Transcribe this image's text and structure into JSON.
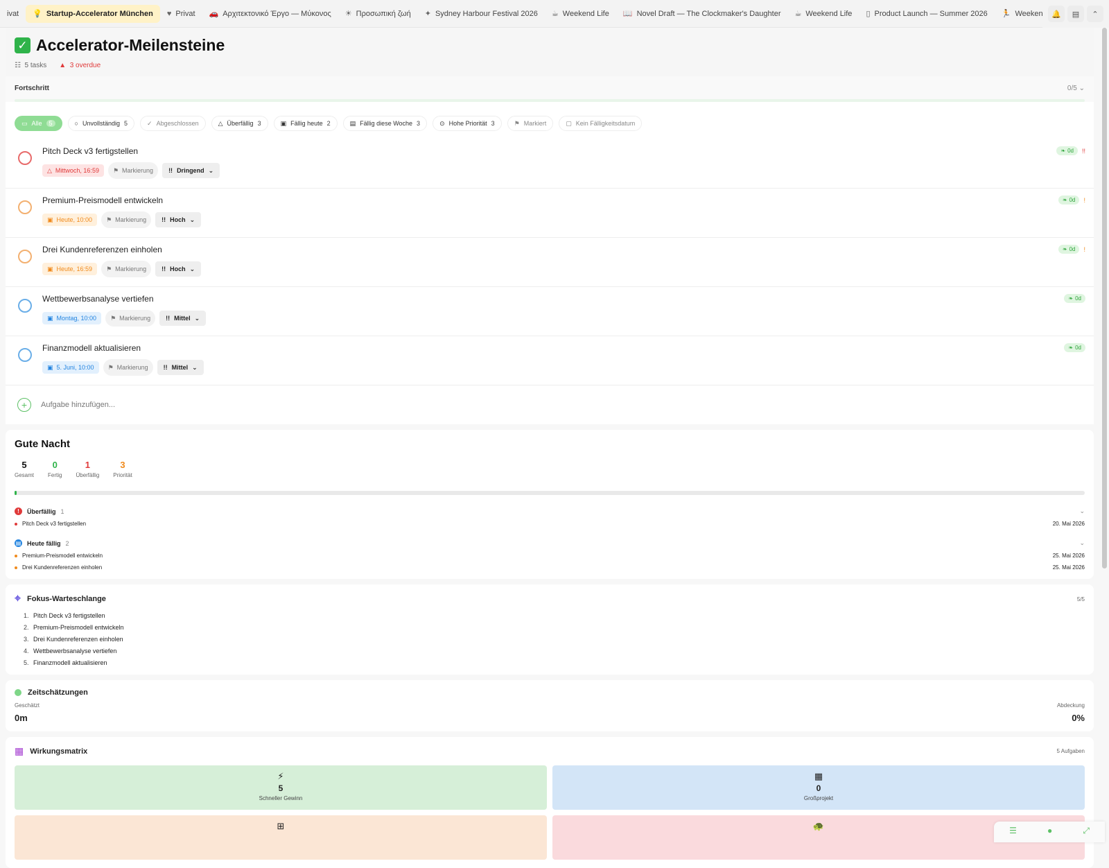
{
  "tabs": [
    {
      "label": "ivat",
      "icon": "heart-icon",
      "active": false
    },
    {
      "label": "Startup-Accelerator München",
      "icon": "lightbulb-icon",
      "active": true
    },
    {
      "label": "Privat",
      "icon": "heart-icon",
      "active": false
    },
    {
      "label": "Αρχιτεκτονικό Έργο — Μύκονος",
      "icon": "car-icon",
      "active": false
    },
    {
      "label": "Προσωπική ζωή",
      "icon": "sun-icon",
      "active": false
    },
    {
      "label": "Sydney Harbour Festival 2026",
      "icon": "sparkle-icon",
      "active": false
    },
    {
      "label": "Weekend Life",
      "icon": "cup-icon",
      "active": false
    },
    {
      "label": "Novel Draft — The Clockmaker's Daughter",
      "icon": "book-icon",
      "active": false
    },
    {
      "label": "Weekend Life",
      "icon": "cup-icon",
      "active": false
    },
    {
      "label": "Product Launch — Summer 2026",
      "icon": "phone-icon",
      "active": false
    },
    {
      "label": "Weekend A",
      "icon": "runner-icon",
      "active": false
    }
  ],
  "header": {
    "title": "Accelerator-Meilensteine",
    "tasks_count": "5 tasks",
    "overdue": "3 overdue"
  },
  "progress": {
    "label": "Fortschritt",
    "fraction": "0/5",
    "value": 0
  },
  "filters": [
    {
      "label": "Alle",
      "count": "5",
      "active": true
    },
    {
      "label": "Unvollständig",
      "count": "5",
      "icon": "circle-icon"
    },
    {
      "label": "Abgeschlossen",
      "count": "",
      "icon": "check-circle-icon",
      "muted": true
    },
    {
      "label": "Überfällig",
      "count": "3",
      "icon": "warning-icon"
    },
    {
      "label": "Fällig heute",
      "count": "2",
      "icon": "calendar-today-icon"
    },
    {
      "label": "Fällig diese Woche",
      "count": "3",
      "icon": "calendar-icon"
    },
    {
      "label": "Hohe Priorität",
      "count": "3",
      "icon": "priority-icon"
    },
    {
      "label": "Markiert",
      "count": "",
      "icon": "flag-icon",
      "muted": true
    },
    {
      "label": "Kein Fälligkeitsdatum",
      "count": "",
      "icon": "calendar-x-icon",
      "muted": true
    }
  ],
  "tasks": [
    {
      "title": "Pitch Deck v3 fertigstellen",
      "due": "Mittwoch, 16:59",
      "due_style": "red",
      "mark": "Markierung",
      "priority": "Dringend",
      "time": "0d",
      "bang": "!!",
      "bang_style": "red",
      "circle_color": "#e86a6a"
    },
    {
      "title": "Premium-Preismodell entwickeln",
      "due": "Heute, 10:00",
      "due_style": "orange",
      "mark": "Markierung",
      "priority": "Hoch",
      "time": "0d",
      "bang": "!",
      "bang_style": "orange",
      "circle_color": "#f3b070"
    },
    {
      "title": "Drei Kundenreferenzen einholen",
      "due": "Heute, 16:59",
      "due_style": "orange",
      "mark": "Markierung",
      "priority": "Hoch",
      "time": "0d",
      "bang": "!",
      "bang_style": "orange",
      "circle_color": "#f3b070"
    },
    {
      "title": "Wettbewerbsanalyse vertiefen",
      "due": "Montag, 10:00",
      "due_style": "blue",
      "mark": "Markierung",
      "priority": "Mittel",
      "time": "0d",
      "bang": "",
      "bang_style": "",
      "circle_color": "#6aaee8"
    },
    {
      "title": "Finanzmodell aktualisieren",
      "due": "5. Juni, 10:00",
      "due_style": "blue",
      "mark": "Markierung",
      "priority": "Mittel",
      "time": "0d",
      "bang": "",
      "bang_style": "",
      "circle_color": "#6aaee8"
    }
  ],
  "add_task_placeholder": "Aufgabe hinzufügen...",
  "summary": {
    "title": "Gute Nacht",
    "stats": [
      {
        "num": "5",
        "label": "Gesamt",
        "color": "#111111"
      },
      {
        "num": "0",
        "label": "Fertig",
        "color": "#2fb34a"
      },
      {
        "num": "1",
        "label": "Überfällig",
        "color": "#e03a3a"
      },
      {
        "num": "3",
        "label": "Priorität",
        "color": "#f08a1c"
      }
    ],
    "progress_value": 0.002,
    "groups": [
      {
        "title": "Überfällig",
        "count": "1",
        "color": "#e03a3a",
        "icon": "alert-icon",
        "items": [
          {
            "title": "Pitch Deck v3 fertigstellen",
            "date": "20. Mai 2026",
            "color": "#e03a3a"
          }
        ]
      },
      {
        "title": "Heute fällig",
        "count": "2",
        "color": "#2384e0",
        "icon": "calendar-icon",
        "items": [
          {
            "title": "Premium-Preismodell entwickeln",
            "date": "25. Mai 2026",
            "color": "#f08a1c"
          },
          {
            "title": "Drei Kundenreferenzen einholen",
            "date": "25. Mai 2026",
            "color": "#f08a1c"
          }
        ]
      }
    ]
  },
  "focus": {
    "title": "Fokus-Warteschlange",
    "count": "5/5",
    "items": [
      "Pitch Deck v3 fertigstellen",
      "Premium-Preismodell entwickeln",
      "Drei Kundenreferenzen einholen",
      "Wettbewerbsanalyse vertiefen",
      "Finanzmodell aktualisieren"
    ]
  },
  "estimates": {
    "title": "Zeitschätzungen",
    "estimated_label": "Geschätzt",
    "estimated_value": "0m",
    "coverage_label": "Abdeckung",
    "coverage_value": "0%"
  },
  "matrix": {
    "title": "Wirkungsmatrix",
    "count": "5 Aufgaben",
    "cells": [
      {
        "icon": "bolt-icon",
        "glyph": "⚡",
        "num": "5",
        "label": "Schneller Gewinn",
        "color": "#d6efd8"
      },
      {
        "icon": "building-icon",
        "glyph": "▦",
        "num": "0",
        "label": "Großprojekt",
        "color": "#d3e5f7"
      },
      {
        "icon": "grid-icon",
        "glyph": "⊞",
        "num": "",
        "label": "",
        "color": "#fbe6d5"
      },
      {
        "icon": "turtle-icon",
        "glyph": "🐢",
        "num": "",
        "label": "",
        "color": "#fadadd"
      }
    ]
  }
}
